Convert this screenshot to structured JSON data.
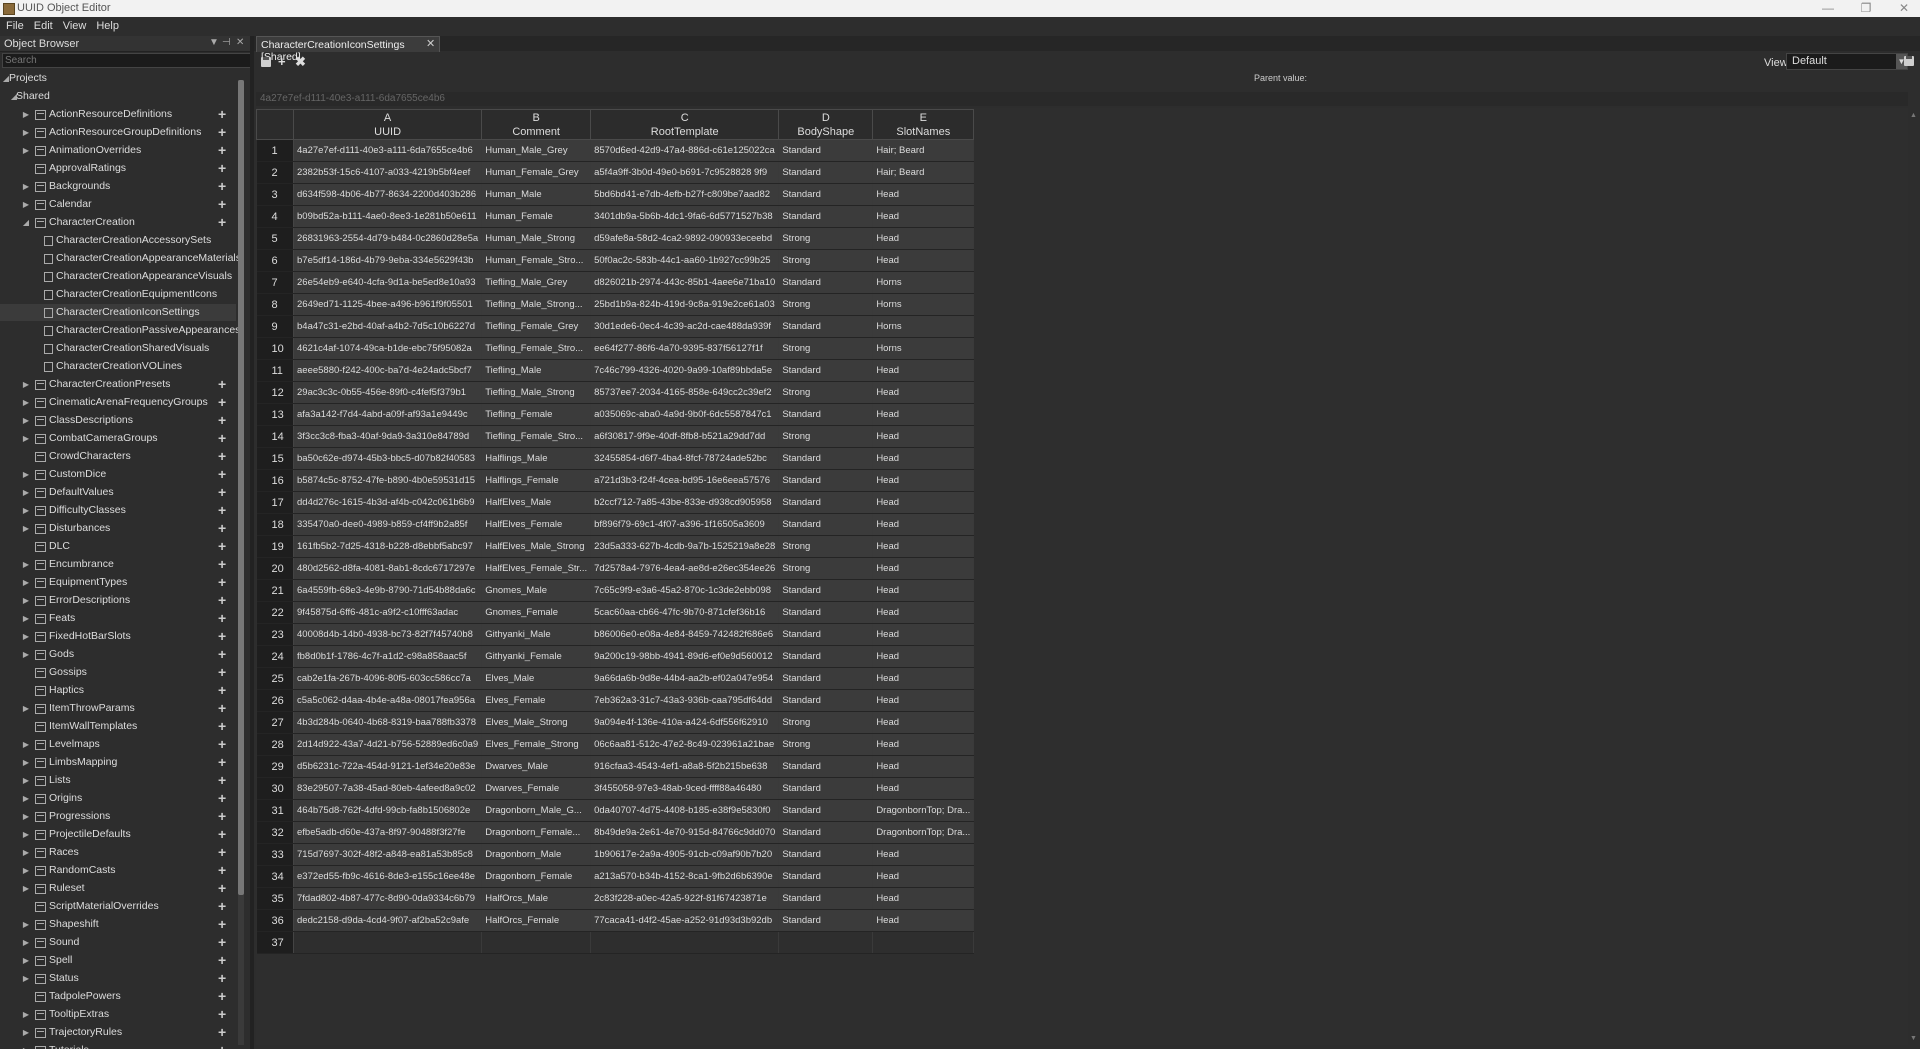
{
  "window": {
    "title": "UUID Object Editor",
    "minimize": "—",
    "restore": "❐",
    "close": "✕"
  },
  "menu": [
    "File",
    "Edit",
    "View",
    "Help"
  ],
  "object_browser": {
    "title": "Object Browser",
    "search_placeholder": "Search",
    "tree": [
      {
        "label": "Projects",
        "level": 0,
        "expanded": true,
        "type": "root"
      },
      {
        "label": "Shared",
        "level": 1,
        "expanded": true,
        "type": "root"
      },
      {
        "label": "ActionResourceDefinitions",
        "level": 2,
        "type": "folder",
        "arrow": true,
        "plus": true
      },
      {
        "label": "ActionResourceGroupDefinitions",
        "level": 2,
        "type": "folder",
        "arrow": true,
        "plus": true
      },
      {
        "label": "AnimationOverrides",
        "level": 2,
        "type": "folder",
        "arrow": true,
        "plus": true
      },
      {
        "label": "ApprovalRatings",
        "level": 2,
        "type": "folder",
        "arrow": false,
        "plus": true
      },
      {
        "label": "Backgrounds",
        "level": 2,
        "type": "folder",
        "arrow": true,
        "plus": true
      },
      {
        "label": "Calendar",
        "level": 2,
        "type": "folder",
        "arrow": true,
        "plus": true
      },
      {
        "label": "CharacterCreation",
        "level": 2,
        "type": "folder",
        "arrow": true,
        "expanded": true,
        "plus": true
      },
      {
        "label": "CharacterCreationAccessorySets",
        "level": 3,
        "type": "doc"
      },
      {
        "label": "CharacterCreationAppearanceMaterials",
        "level": 3,
        "type": "doc"
      },
      {
        "label": "CharacterCreationAppearanceVisuals",
        "level": 3,
        "type": "doc"
      },
      {
        "label": "CharacterCreationEquipmentIcons",
        "level": 3,
        "type": "doc"
      },
      {
        "label": "CharacterCreationIconSettings",
        "level": 3,
        "type": "doc",
        "selected": true
      },
      {
        "label": "CharacterCreationPassiveAppearances",
        "level": 3,
        "type": "doc"
      },
      {
        "label": "CharacterCreationSharedVisuals",
        "level": 3,
        "type": "doc"
      },
      {
        "label": "CharacterCreationVOLines",
        "level": 3,
        "type": "doc"
      },
      {
        "label": "CharacterCreationPresets",
        "level": 2,
        "type": "folder",
        "arrow": true,
        "plus": true
      },
      {
        "label": "CinematicArenaFrequencyGroups",
        "level": 2,
        "type": "folder",
        "arrow": true,
        "plus": true
      },
      {
        "label": "ClassDescriptions",
        "level": 2,
        "type": "folder",
        "arrow": true,
        "plus": true
      },
      {
        "label": "CombatCameraGroups",
        "level": 2,
        "type": "folder",
        "arrow": true,
        "plus": true
      },
      {
        "label": "CrowdCharacters",
        "level": 2,
        "type": "folder",
        "arrow": false,
        "plus": true
      },
      {
        "label": "CustomDice",
        "level": 2,
        "type": "folder",
        "arrow": true,
        "plus": true
      },
      {
        "label": "DefaultValues",
        "level": 2,
        "type": "folder",
        "arrow": true,
        "plus": true
      },
      {
        "label": "DifficultyClasses",
        "level": 2,
        "type": "folder",
        "arrow": true,
        "plus": true
      },
      {
        "label": "Disturbances",
        "level": 2,
        "type": "folder",
        "arrow": true,
        "plus": true
      },
      {
        "label": "DLC",
        "level": 2,
        "type": "folder",
        "arrow": false,
        "plus": true
      },
      {
        "label": "Encumbrance",
        "level": 2,
        "type": "folder",
        "arrow": true,
        "plus": true
      },
      {
        "label": "EquipmentTypes",
        "level": 2,
        "type": "folder",
        "arrow": true,
        "plus": true
      },
      {
        "label": "ErrorDescriptions",
        "level": 2,
        "type": "folder",
        "arrow": true,
        "plus": true
      },
      {
        "label": "Feats",
        "level": 2,
        "type": "folder",
        "arrow": true,
        "plus": true
      },
      {
        "label": "FixedHotBarSlots",
        "level": 2,
        "type": "folder",
        "arrow": true,
        "plus": true
      },
      {
        "label": "Gods",
        "level": 2,
        "type": "folder",
        "arrow": true,
        "plus": true
      },
      {
        "label": "Gossips",
        "level": 2,
        "type": "folder",
        "arrow": false,
        "plus": true
      },
      {
        "label": "Haptics",
        "level": 2,
        "type": "folder",
        "arrow": false,
        "plus": true
      },
      {
        "label": "ItemThrowParams",
        "level": 2,
        "type": "folder",
        "arrow": true,
        "plus": true
      },
      {
        "label": "ItemWallTemplates",
        "level": 2,
        "type": "folder",
        "arrow": false,
        "plus": true
      },
      {
        "label": "Levelmaps",
        "level": 2,
        "type": "folder",
        "arrow": true,
        "plus": true
      },
      {
        "label": "LimbsMapping",
        "level": 2,
        "type": "folder",
        "arrow": true,
        "plus": true
      },
      {
        "label": "Lists",
        "level": 2,
        "type": "folder",
        "arrow": true,
        "plus": true
      },
      {
        "label": "Origins",
        "level": 2,
        "type": "folder",
        "arrow": true,
        "plus": true
      },
      {
        "label": "Progressions",
        "level": 2,
        "type": "folder",
        "arrow": true,
        "plus": true
      },
      {
        "label": "ProjectileDefaults",
        "level": 2,
        "type": "folder",
        "arrow": true,
        "plus": true
      },
      {
        "label": "Races",
        "level": 2,
        "type": "folder",
        "arrow": true,
        "plus": true
      },
      {
        "label": "RandomCasts",
        "level": 2,
        "type": "folder",
        "arrow": true,
        "plus": true
      },
      {
        "label": "Ruleset",
        "level": 2,
        "type": "folder",
        "arrow": true,
        "plus": true
      },
      {
        "label": "ScriptMaterialOverrides",
        "level": 2,
        "type": "folder",
        "arrow": false,
        "plus": true
      },
      {
        "label": "Shapeshift",
        "level": 2,
        "type": "folder",
        "arrow": true,
        "plus": true
      },
      {
        "label": "Sound",
        "level": 2,
        "type": "folder",
        "arrow": true,
        "plus": true
      },
      {
        "label": "Spell",
        "level": 2,
        "type": "folder",
        "arrow": true,
        "plus": true
      },
      {
        "label": "Status",
        "level": 2,
        "type": "folder",
        "arrow": true,
        "plus": true
      },
      {
        "label": "TadpolePowers",
        "level": 2,
        "type": "folder",
        "arrow": false,
        "plus": true
      },
      {
        "label": "TooltipExtras",
        "level": 2,
        "type": "folder",
        "arrow": true,
        "plus": true
      },
      {
        "label": "TrajectoryRules",
        "level": 2,
        "type": "folder",
        "arrow": true,
        "plus": true
      },
      {
        "label": "Tutorials",
        "level": 2,
        "type": "folder",
        "arrow": true,
        "plus": true
      }
    ]
  },
  "editor": {
    "tab_label": "CharacterCreationIconSettings [Shared]",
    "view_label": "View:",
    "view_value": "Default",
    "parent_value_label": "Parent value:",
    "parent_value": "4a27e7ef-d111-40e3-a111-6da7655ce4b6"
  },
  "grid": {
    "columns": [
      {
        "letter": "A",
        "name": "UUID"
      },
      {
        "letter": "B",
        "name": "Comment"
      },
      {
        "letter": "C",
        "name": "RootTemplate"
      },
      {
        "letter": "D",
        "name": "BodyShape"
      },
      {
        "letter": "E",
        "name": "SlotNames"
      }
    ],
    "rows": [
      [
        "4a27e7ef-d111-40e3-a111-6da7655ce4b6",
        "Human_Male_Grey",
        "8570d6ed-42d9-47a4-886d-c61e125022ca",
        "Standard",
        "Hair; Beard"
      ],
      [
        "2382b53f-15c6-4107-a033-4219b5bf4eef",
        "Human_Female_Grey",
        "a5f4a9ff-3b0d-49e0-b691-7c9528828 9f9",
        "Standard",
        "Hair; Beard"
      ],
      [
        "d634f598-4b06-4b77-8634-2200d403b286",
        "Human_Male",
        "5bd6bd41-e7db-4efb-b27f-c809be7aad82",
        "Standard",
        "Head"
      ],
      [
        "b09bd52a-b111-4ae0-8ee3-1e281b50e611",
        "Human_Female",
        "3401db9a-5b6b-4dc1-9fa6-6d5771527b38",
        "Standard",
        "Head"
      ],
      [
        "26831963-2554-4d79-b484-0c2860d28e5a",
        "Human_Male_Strong",
        "d59afe8a-58d2-4ca2-9892-090933eceebd",
        "Strong",
        "Head"
      ],
      [
        "b7e5df14-186d-4b79-9eba-334e5629f43b",
        "Human_Female_Stro...",
        "50f0ac2c-583b-44c1-aa60-1b927cc99b25",
        "Strong",
        "Head"
      ],
      [
        "26e54eb9-e640-4cfa-9d1a-be5ed8e10a93",
        "Tiefling_Male_Grey",
        "d826021b-2974-443c-85b1-4aee6e71ba10",
        "Standard",
        "Horns"
      ],
      [
        "2649ed71-1125-4bee-a496-b961f9f05501",
        "Tiefling_Male_Strong...",
        "25bd1b9a-824b-419d-9c8a-919e2ce61a03",
        "Strong",
        "Horns"
      ],
      [
        "b4a47c31-e2bd-40af-a4b2-7d5c10b6227d",
        "Tiefling_Female_Grey",
        "30d1ede6-0ec4-4c39-ac2d-cae488da939f",
        "Standard",
        "Horns"
      ],
      [
        "4621c4af-1074-49ca-b1de-ebc75f95082a",
        "Tiefling_Female_Stro...",
        "ee64f277-86f6-4a70-9395-837f56127f1f",
        "Strong",
        "Horns"
      ],
      [
        "aeee5880-f242-400c-ba7d-4e24adc5bcf7",
        "Tiefling_Male",
        "7c46c799-4326-4020-9a99-10af89bbda5e",
        "Standard",
        "Head"
      ],
      [
        "29ac3c3c-0b55-456e-89f0-c4fef5f379b1",
        "Tiefling_Male_Strong",
        "85737ee7-2034-4165-858e-649cc2c39ef2",
        "Strong",
        "Head"
      ],
      [
        "afa3a142-f7d4-4abd-a09f-af93a1e9449c",
        "Tiefling_Female",
        "a035069c-aba0-4a9d-9b0f-6dc5587847c1",
        "Standard",
        "Head"
      ],
      [
        "3f3cc3c8-fba3-40af-9da9-3a310e84789d",
        "Tiefling_Female_Stro...",
        "a6f30817-9f9e-40df-8fb8-b521a29dd7dd",
        "Strong",
        "Head"
      ],
      [
        "ba50c62e-d974-45b3-bbc5-d07b82f40583",
        "Halflings_Male",
        "32455854-d6f7-4ba4-8fcf-78724ade52bc",
        "Standard",
        "Head"
      ],
      [
        "b5874c5c-8752-47fe-b890-4b0e59531d15",
        "Halflings_Female",
        "a721d3b3-f24f-4cea-bd95-16e6eea57576",
        "Standard",
        "Head"
      ],
      [
        "dd4d276c-1615-4b3d-af4b-c042c061b6b9",
        "HalfElves_Male",
        "b2ccf712-7a85-43be-833e-d938cd905958",
        "Standard",
        "Head"
      ],
      [
        "335470a0-dee0-4989-b859-cf4ff9b2a85f",
        "HalfElves_Female",
        "bf896f79-69c1-4f07-a396-1f16505a3609",
        "Standard",
        "Head"
      ],
      [
        "161fb5b2-7d25-4318-b228-d8ebbf5abc97",
        "HalfElves_Male_Strong",
        "23d5a333-627b-4cdb-9a7b-1525219a8e28",
        "Strong",
        "Head"
      ],
      [
        "480d2562-d8fa-4081-8ab1-8cdc6717297e",
        "HalfElves_Female_Str...",
        "7d2578a4-7976-4ea4-ae8d-e26ec354ee26",
        "Strong",
        "Head"
      ],
      [
        "6a4559fb-68e3-4e9b-8790-71d54b88da6c",
        "Gnomes_Male",
        "7c65c9f9-e3a6-45a2-870c-1c3de2ebb098",
        "Standard",
        "Head"
      ],
      [
        "9f45875d-6ff6-481c-a9f2-c10fff63adac",
        "Gnomes_Female",
        "5cac60aa-cb66-47fc-9b70-871cfef36b16",
        "Standard",
        "Head"
      ],
      [
        "40008d4b-14b0-4938-bc73-82f7f45740b8",
        "Githyanki_Male",
        "b86006e0-e08a-4e84-8459-742482f686e6",
        "Standard",
        "Head"
      ],
      [
        "fb8d0b1f-1786-4c7f-a1d2-c98a858aac5f",
        "Githyanki_Female",
        "9a200c19-98bb-4941-89d6-ef0e9d560012",
        "Standard",
        "Head"
      ],
      [
        "cab2e1fa-267b-4096-80f5-603cc586cc7a",
        "Elves_Male",
        "9a66da6b-9d8e-44b4-aa2b-ef02a047e954",
        "Standard",
        "Head"
      ],
      [
        "c5a5c062-d4aa-4b4e-a48a-08017fea956a",
        "Elves_Female",
        "7eb362a3-31c7-43a3-936b-caa795df64dd",
        "Standard",
        "Head"
      ],
      [
        "4b3d284b-0640-4b68-8319-baa788fb3378",
        "Elves_Male_Strong",
        "9a094e4f-136e-410a-a424-6df556f62910",
        "Strong",
        "Head"
      ],
      [
        "2d14d922-43a7-4d21-b756-52889ed6c0a9",
        "Elves_Female_Strong",
        "06c6aa81-512c-47e2-8c49-023961a21bae",
        "Strong",
        "Head"
      ],
      [
        "d5b6231c-722a-454d-9121-1ef34e20e83e",
        "Dwarves_Male",
        "916cfaa3-4543-4ef1-a8a8-5f2b215be638",
        "Standard",
        "Head"
      ],
      [
        "83e29507-7a38-45ad-80eb-4afeed8a9c02",
        "Dwarves_Female",
        "3f455058-97e3-48ab-9ced-ffff88a46480",
        "Standard",
        "Head"
      ],
      [
        "464b75d8-762f-4dfd-99cb-fa8b1506802e",
        "Dragonborn_Male_G...",
        "0da40707-4d75-4408-b185-e38f9e5830f0",
        "Standard",
        "DragonbornTop; Dra..."
      ],
      [
        "efbe5adb-d60e-437a-8f97-90488f3f27fe",
        "Dragonborn_Female...",
        "8b49de9a-2e61-4e70-915d-84766c9dd070",
        "Standard",
        "DragonbornTop; Dra..."
      ],
      [
        "715d7697-302f-48f2-a848-ea81a53b85c8",
        "Dragonborn_Male",
        "1b90617e-2a9a-4905-91cb-c09af90b7b20",
        "Standard",
        "Head"
      ],
      [
        "e372ed55-fb9c-4616-8de3-e155c16ee48e",
        "Dragonborn_Female",
        "a213a570-b34b-4152-8ca1-9fb2d6b6390e",
        "Standard",
        "Head"
      ],
      [
        "7fdad802-4b87-477c-8d90-0da9334c6b79",
        "HalfOrcs_Male",
        "2c83f228-a0ec-42a5-922f-81f67423871e",
        "Standard",
        "Head"
      ],
      [
        "dedc2158-d9da-4cd4-9f07-af2ba52c9afe",
        "HalfOrcs_Female",
        "77caca41-d4f2-45ae-a252-91d93d3b92db",
        "Standard",
        "Head"
      ],
      [
        "",
        "",
        "",
        "",
        ""
      ]
    ]
  }
}
